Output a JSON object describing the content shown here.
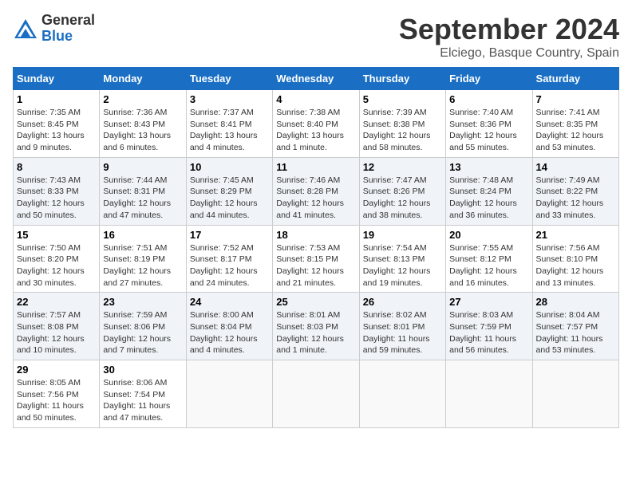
{
  "header": {
    "logo_general": "General",
    "logo_blue": "Blue",
    "month_title": "September 2024",
    "location": "Elciego, Basque Country, Spain"
  },
  "weekdays": [
    "Sunday",
    "Monday",
    "Tuesday",
    "Wednesday",
    "Thursday",
    "Friday",
    "Saturday"
  ],
  "weeks": [
    [
      {
        "day": "1",
        "sunrise": "7:35 AM",
        "sunset": "8:45 PM",
        "daylight": "13 hours and 9 minutes."
      },
      {
        "day": "2",
        "sunrise": "7:36 AM",
        "sunset": "8:43 PM",
        "daylight": "13 hours and 6 minutes."
      },
      {
        "day": "3",
        "sunrise": "7:37 AM",
        "sunset": "8:41 PM",
        "daylight": "13 hours and 4 minutes."
      },
      {
        "day": "4",
        "sunrise": "7:38 AM",
        "sunset": "8:40 PM",
        "daylight": "13 hours and 1 minute."
      },
      {
        "day": "5",
        "sunrise": "7:39 AM",
        "sunset": "8:38 PM",
        "daylight": "12 hours and 58 minutes."
      },
      {
        "day": "6",
        "sunrise": "7:40 AM",
        "sunset": "8:36 PM",
        "daylight": "12 hours and 55 minutes."
      },
      {
        "day": "7",
        "sunrise": "7:41 AM",
        "sunset": "8:35 PM",
        "daylight": "12 hours and 53 minutes."
      }
    ],
    [
      {
        "day": "8",
        "sunrise": "7:43 AM",
        "sunset": "8:33 PM",
        "daylight": "12 hours and 50 minutes."
      },
      {
        "day": "9",
        "sunrise": "7:44 AM",
        "sunset": "8:31 PM",
        "daylight": "12 hours and 47 minutes."
      },
      {
        "day": "10",
        "sunrise": "7:45 AM",
        "sunset": "8:29 PM",
        "daylight": "12 hours and 44 minutes."
      },
      {
        "day": "11",
        "sunrise": "7:46 AM",
        "sunset": "8:28 PM",
        "daylight": "12 hours and 41 minutes."
      },
      {
        "day": "12",
        "sunrise": "7:47 AM",
        "sunset": "8:26 PM",
        "daylight": "12 hours and 38 minutes."
      },
      {
        "day": "13",
        "sunrise": "7:48 AM",
        "sunset": "8:24 PM",
        "daylight": "12 hours and 36 minutes."
      },
      {
        "day": "14",
        "sunrise": "7:49 AM",
        "sunset": "8:22 PM",
        "daylight": "12 hours and 33 minutes."
      }
    ],
    [
      {
        "day": "15",
        "sunrise": "7:50 AM",
        "sunset": "8:20 PM",
        "daylight": "12 hours and 30 minutes."
      },
      {
        "day": "16",
        "sunrise": "7:51 AM",
        "sunset": "8:19 PM",
        "daylight": "12 hours and 27 minutes."
      },
      {
        "day": "17",
        "sunrise": "7:52 AM",
        "sunset": "8:17 PM",
        "daylight": "12 hours and 24 minutes."
      },
      {
        "day": "18",
        "sunrise": "7:53 AM",
        "sunset": "8:15 PM",
        "daylight": "12 hours and 21 minutes."
      },
      {
        "day": "19",
        "sunrise": "7:54 AM",
        "sunset": "8:13 PM",
        "daylight": "12 hours and 19 minutes."
      },
      {
        "day": "20",
        "sunrise": "7:55 AM",
        "sunset": "8:12 PM",
        "daylight": "12 hours and 16 minutes."
      },
      {
        "day": "21",
        "sunrise": "7:56 AM",
        "sunset": "8:10 PM",
        "daylight": "12 hours and 13 minutes."
      }
    ],
    [
      {
        "day": "22",
        "sunrise": "7:57 AM",
        "sunset": "8:08 PM",
        "daylight": "12 hours and 10 minutes."
      },
      {
        "day": "23",
        "sunrise": "7:59 AM",
        "sunset": "8:06 PM",
        "daylight": "12 hours and 7 minutes."
      },
      {
        "day": "24",
        "sunrise": "8:00 AM",
        "sunset": "8:04 PM",
        "daylight": "12 hours and 4 minutes."
      },
      {
        "day": "25",
        "sunrise": "8:01 AM",
        "sunset": "8:03 PM",
        "daylight": "12 hours and 1 minute."
      },
      {
        "day": "26",
        "sunrise": "8:02 AM",
        "sunset": "8:01 PM",
        "daylight": "11 hours and 59 minutes."
      },
      {
        "day": "27",
        "sunrise": "8:03 AM",
        "sunset": "7:59 PM",
        "daylight": "11 hours and 56 minutes."
      },
      {
        "day": "28",
        "sunrise": "8:04 AM",
        "sunset": "7:57 PM",
        "daylight": "11 hours and 53 minutes."
      }
    ],
    [
      {
        "day": "29",
        "sunrise": "8:05 AM",
        "sunset": "7:56 PM",
        "daylight": "11 hours and 50 minutes."
      },
      {
        "day": "30",
        "sunrise": "8:06 AM",
        "sunset": "7:54 PM",
        "daylight": "11 hours and 47 minutes."
      },
      null,
      null,
      null,
      null,
      null
    ]
  ]
}
